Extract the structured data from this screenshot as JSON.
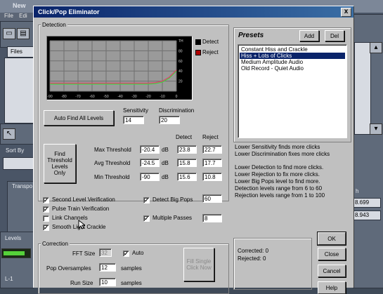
{
  "background_app": {
    "title": "New",
    "menu": [
      "File",
      "Edi"
    ],
    "tabs": [
      "Files"
    ],
    "labels": [
      "Sort By",
      "Transpo",
      "Levels",
      "L-1",
      "L-1"
    ],
    "right_values": [
      "8.699",
      "8.943"
    ],
    "right_label": "h"
  },
  "dialog": {
    "title": "Click/Pop Eliminator",
    "close_glyph": "x"
  },
  "detection": {
    "group_label": "Detection",
    "legend": [
      {
        "label": "Detect",
        "color": "#000000"
      },
      {
        "label": "Reject",
        "color": "#b00000"
      }
    ],
    "auto_find_label": "Auto Find All Levels",
    "sensitivity_label": "Sensitivity",
    "sensitivity_value": "14",
    "discrimination_label": "Discrimination",
    "discrimination_value": "20",
    "find_levels_label": "Find Threshold Levels Only",
    "col_detect": "Detect",
    "col_reject": "Reject",
    "rows": [
      {
        "label": "Max Threshold",
        "db": "-20.4",
        "unit": "dB",
        "detect": "23.8",
        "reject": "22.7"
      },
      {
        "label": "Avg Threshold",
        "db": "-24.5",
        "unit": "dB",
        "detect": "15.8",
        "reject": "17.7"
      },
      {
        "label": "Min Threshold",
        "db": "-90",
        "unit": "dB",
        "detect": "15.6",
        "reject": "10.8"
      }
    ]
  },
  "chart_data": {
    "type": "line",
    "title": "",
    "x_ticks": [
      "-90",
      "-80",
      "-70",
      "-60",
      "-50",
      "-40",
      "-30",
      "-20",
      "-10",
      "0"
    ],
    "y_ticks_right": [
      "TH",
      "80",
      "60",
      "40",
      "20",
      ""
    ],
    "series": [
      {
        "name": "Detect",
        "color": "#3fd23f",
        "x": [
          -90,
          -50,
          -30,
          -20,
          -15,
          -10,
          -5,
          0
        ],
        "y": [
          14,
          14,
          14,
          14,
          15,
          18,
          26,
          40
        ]
      },
      {
        "name": "Reject",
        "color": "#e0406a",
        "x": [
          -90,
          -50,
          -30,
          -20,
          -15,
          -10,
          -5,
          0
        ],
        "y": [
          16,
          16,
          16,
          16,
          17,
          20,
          28,
          42
        ]
      }
    ],
    "xlim": [
      -90,
      0
    ],
    "ylim": [
      0,
      100
    ],
    "grid": true
  },
  "options": {
    "items": [
      {
        "label": "Second Level Verification",
        "checked": true
      },
      {
        "label": "Pulse Train Verification",
        "checked": true
      },
      {
        "label": "Link Channels",
        "checked": false
      },
      {
        "label": "Smooth Light Crackle",
        "checked": true
      }
    ],
    "detect_big_pops_label": "Detect Big Pops",
    "detect_big_pops_checked": true,
    "detect_big_pops_value": "60",
    "multiple_passes_label": "Multiple Passes",
    "multiple_passes_checked": true,
    "multiple_passes_value": "8"
  },
  "presets": {
    "title": "Presets",
    "add_label": "Add",
    "del_label": "Del",
    "items": [
      "Constant Hiss and Crackle",
      "Hiss + Lots of Clicks",
      "Medium Amplitude Audio",
      "Old Record - Quiet Audio"
    ],
    "selected_index": 1
  },
  "hints": {
    "line1": "Lower Sensitivity finds more clicks",
    "line2": "Lower Discrimination fixes more clicks",
    "line3": "Lower Detection to find more clicks.",
    "line4": "Lower Rejection to fix more clicks.",
    "line5": "Lower Big Pops level to find more.",
    "line6": "Detection levels range from 6 to 60",
    "line7": "Rejection levels range from 1 to 100"
  },
  "correction": {
    "group_label": "Correction",
    "fft_label": "FFT Size",
    "fft_value": "32",
    "auto_label": "Auto",
    "auto_checked": true,
    "pop_over_label": "Pop Oversamples",
    "pop_over_value": "12",
    "samples_label": "samples",
    "run_label": "Run Size",
    "run_value": "10",
    "fill_label": "Fill Single Click Now"
  },
  "status": {
    "corrected": "Corrected: 0",
    "rejected": "Rejected: 0"
  },
  "buttons": {
    "ok": "OK",
    "close": "Close",
    "cancel": "Cancel",
    "help": "Help"
  }
}
